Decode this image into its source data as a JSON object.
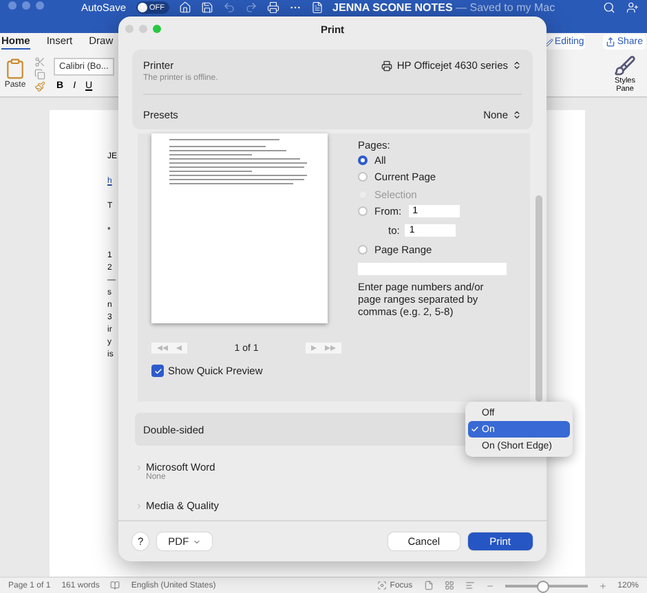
{
  "word": {
    "title_bar": {
      "autosave_label": "AutoSave",
      "autosave_toggle": {
        "on": false,
        "label": "OFF"
      },
      "document_title": "JENNA SCONE NOTES",
      "save_status": "— Saved to my Mac"
    },
    "ribbon_tabs": [
      {
        "label": "Home",
        "selected": true
      },
      {
        "label": "Insert",
        "selected": false
      },
      {
        "label": "Draw",
        "selected": false
      }
    ],
    "editing_button": "Editing",
    "share_button": "Share",
    "paste_label": "Paste",
    "font_name": "Calibri (Bo...",
    "format_buttons": [
      "B",
      "I",
      "U"
    ],
    "styles_pane_label": "Styles Pane",
    "document_fragments": [
      {
        "text": "JE",
        "kind": "paragraph"
      },
      {
        "text": "h",
        "kind": "link"
      },
      {
        "text": "T",
        "kind": "paragraph"
      },
      {
        "text": "*",
        "kind": "paragraph"
      },
      {
        "text": "1",
        "kind": "line"
      },
      {
        "text": "2",
        "kind": "line"
      },
      {
        "text": "—",
        "kind": "line"
      },
      {
        "text": "s",
        "kind": "line"
      },
      {
        "text": "n",
        "kind": "line"
      },
      {
        "text": "3",
        "kind": "line"
      },
      {
        "text": "ir",
        "kind": "line"
      },
      {
        "text": "y",
        "kind": "line"
      },
      {
        "text": "is",
        "kind": "line"
      }
    ],
    "status_bar": {
      "page": "Page 1 of 1",
      "words": "161 words",
      "language": "English (United States)",
      "focus": "Focus",
      "zoom": "120%",
      "zoom_slider": {
        "level": 0.45
      }
    }
  },
  "print_dialog": {
    "title": "Print",
    "printer": {
      "label": "Printer",
      "value": "HP Officejet 4630 series",
      "status": "The printer is offline."
    },
    "presets": {
      "label": "Presets",
      "value": "None"
    },
    "preview": {
      "page_counter": "1 of 1",
      "show_quick_preview": {
        "label": "Show Quick Preview",
        "checked": true
      }
    },
    "pages": {
      "label": "Pages:",
      "options": [
        {
          "label": "All",
          "kind": "plain",
          "selected": true,
          "disabled": false
        },
        {
          "label": "Current Page",
          "kind": "plain",
          "selected": false,
          "disabled": false
        },
        {
          "label": "Selection",
          "kind": "plain",
          "selected": false,
          "disabled": true
        },
        {
          "label": "From:",
          "kind": "from",
          "selected": false,
          "disabled": false,
          "value": "1",
          "to_label": "to:",
          "to_value": "1"
        },
        {
          "label": "Page Range",
          "kind": "range",
          "selected": false,
          "disabled": false
        }
      ],
      "help": "Enter page numbers and/or page ranges separated by commas (e.g. 2, 5-8)"
    },
    "double_sided": {
      "label": "Double-sided",
      "menu": [
        {
          "label": "Off",
          "selected": false
        },
        {
          "label": "On",
          "selected": true
        },
        {
          "label": "On (Short Edge)",
          "selected": false
        }
      ]
    },
    "sections": [
      {
        "label": "Microsoft Word",
        "summary": "None"
      },
      {
        "label": "Media & Quality"
      }
    ],
    "footer": {
      "help": "?",
      "pdf": "PDF",
      "cancel": "Cancel",
      "print": "Print"
    }
  }
}
